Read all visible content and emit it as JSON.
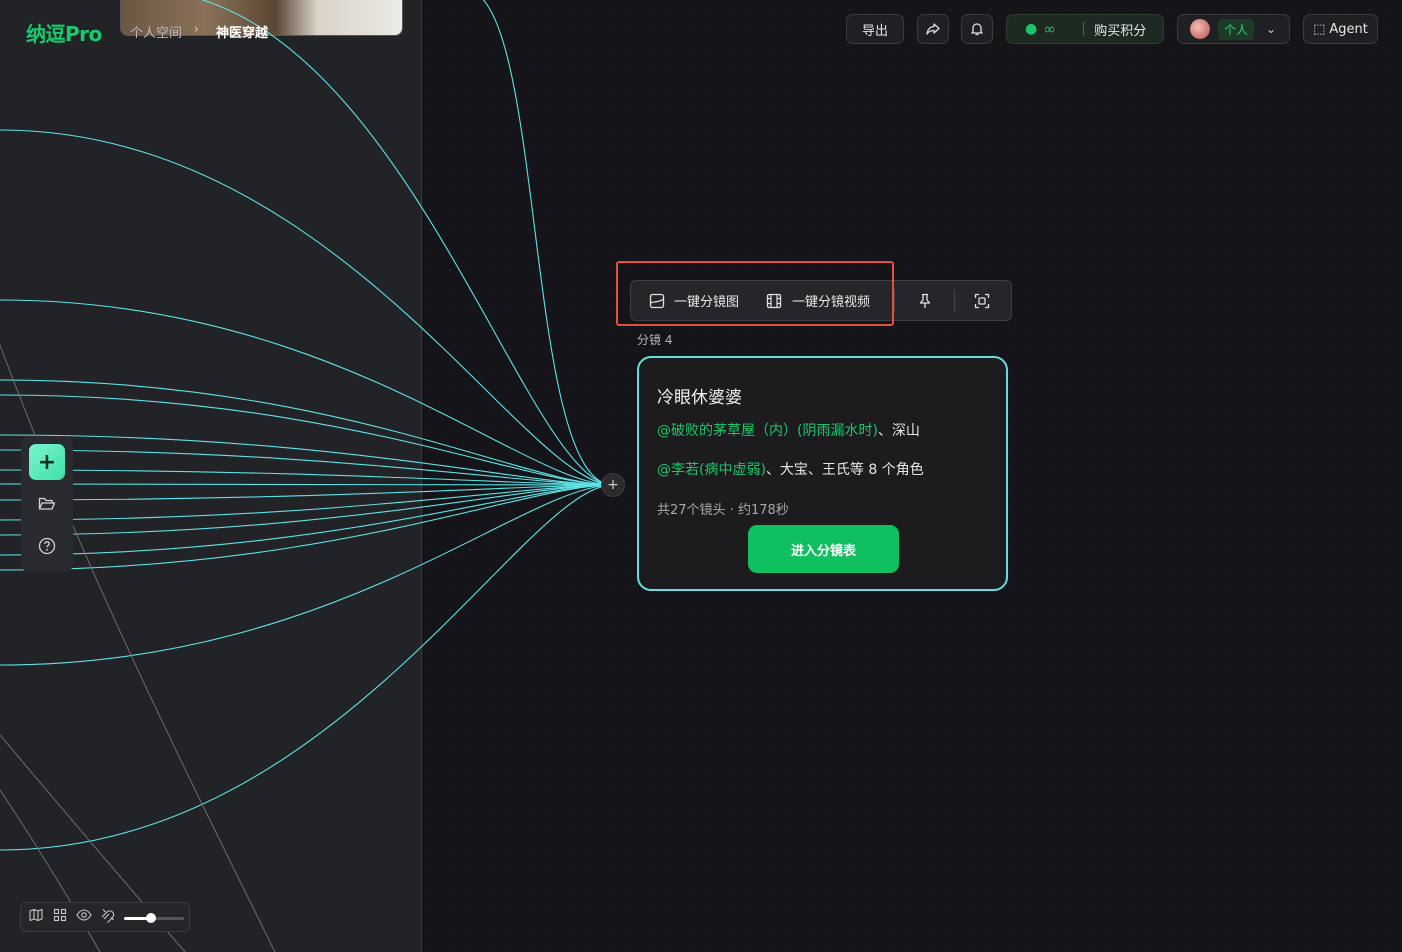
{
  "header": {
    "logo": "纳逗Pro",
    "breadcrumb": {
      "space": "个人空间",
      "separator": "›",
      "project": "神医穿越"
    },
    "export_label": "导出",
    "points": {
      "value": "∞",
      "buy_label": "购买积分"
    },
    "user": {
      "tag": "个人"
    },
    "agent_label": "Agent"
  },
  "node_toolbar": {
    "storyboard_image_label": "一键分镜图",
    "storyboard_video_label": "一键分镜视频"
  },
  "shot": {
    "label": "分镜 4",
    "title": "冷眼休婆婆",
    "scene_mention": "@破败的茅草屋（内）(阴雨漏水时)",
    "scene_rest": "、深山",
    "character_mention": "@李若(病中虚弱)",
    "character_rest": "、大宝、王氏等 8 个角色",
    "meta": "共27个镜头 · 约178秒",
    "enter_label": "进入分镜表"
  },
  "zoom": {
    "level": 0.45
  },
  "colors": {
    "accent": "#10c060",
    "edge": "#5ee3e8",
    "highlight": "#e3503f"
  }
}
